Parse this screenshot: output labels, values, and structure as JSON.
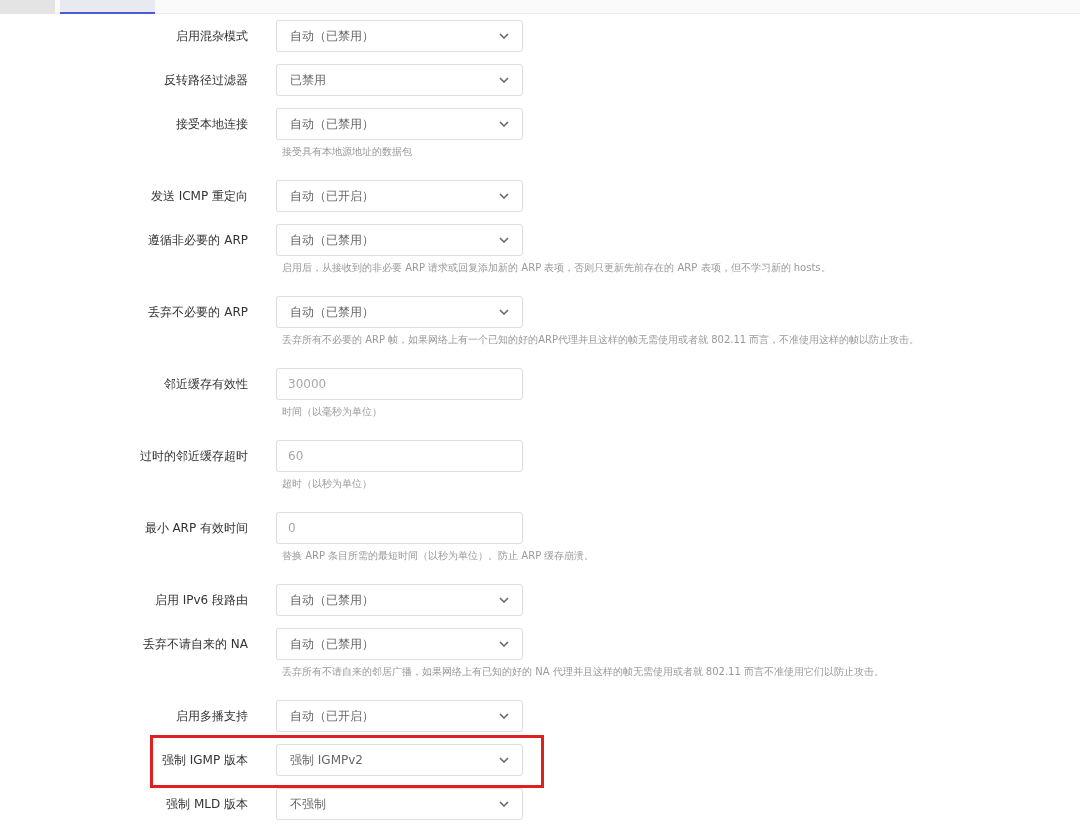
{
  "tabs": [
    {
      "selected": false
    },
    {
      "selected": true
    }
  ],
  "rows": [
    {
      "label": "启用混杂模式",
      "kind": "select",
      "value": "自动（已禁用）"
    },
    {
      "label": "反转路径过滤器",
      "kind": "select",
      "value": "已禁用"
    },
    {
      "label": "接受本地连接",
      "kind": "select",
      "value": "自动（已禁用）",
      "help": "接受具有本地源地址的数据包"
    },
    {
      "label": "发送 ICMP 重定向",
      "kind": "select",
      "value": "自动（已开启）"
    },
    {
      "label": "遵循非必要的 ARP",
      "kind": "select",
      "value": "自动（已禁用）",
      "help": "启用后，从接收到的非必要 ARP 请求或回复添加新的 ARP 表项，否则只更新先前存在的 ARP 表项，但不学习新的 hosts。"
    },
    {
      "label": "丢弃不必要的 ARP",
      "kind": "select",
      "value": "自动（已禁用）",
      "help": "丢弃所有不必要的 ARP 帧，如果网络上有一个已知的好的ARP代理并且这样的帧无需使用或者就 802.11 而言，不准使用这样的帧以防止攻击。"
    },
    {
      "label": "邻近缓存有效性",
      "kind": "input",
      "placeholder": "30000",
      "help": "时间（以毫秒为单位）"
    },
    {
      "label": "过时的邻近缓存超时",
      "kind": "input",
      "placeholder": "60",
      "help": "超时（以秒为单位）"
    },
    {
      "label": "最小 ARP 有效时间",
      "kind": "input",
      "placeholder": "0",
      "help": "替换 ARP 条目所需的最短时间（以秒为单位）。防止 ARP 缓存崩溃。"
    },
    {
      "label": "启用 IPv6 段路由",
      "kind": "select",
      "value": "自动（已禁用）"
    },
    {
      "label": "丢弃不请自来的 NA",
      "kind": "select",
      "value": "自动（已禁用）",
      "help": "丢弃所有不请自来的邻居广播，如果网络上有已知的好的 NA 代理并且这样的帧无需使用或者就 802.11 而言不准使用它们以防止攻击。"
    },
    {
      "label": "启用多播支持",
      "kind": "select",
      "value": "自动（已开启）"
    },
    {
      "label": "强制 IGMP 版本",
      "kind": "select",
      "value": "强制 IGMPv2",
      "highlighted": true
    },
    {
      "label": "强制 MLD 版本",
      "kind": "select",
      "value": "不强制"
    }
  ]
}
